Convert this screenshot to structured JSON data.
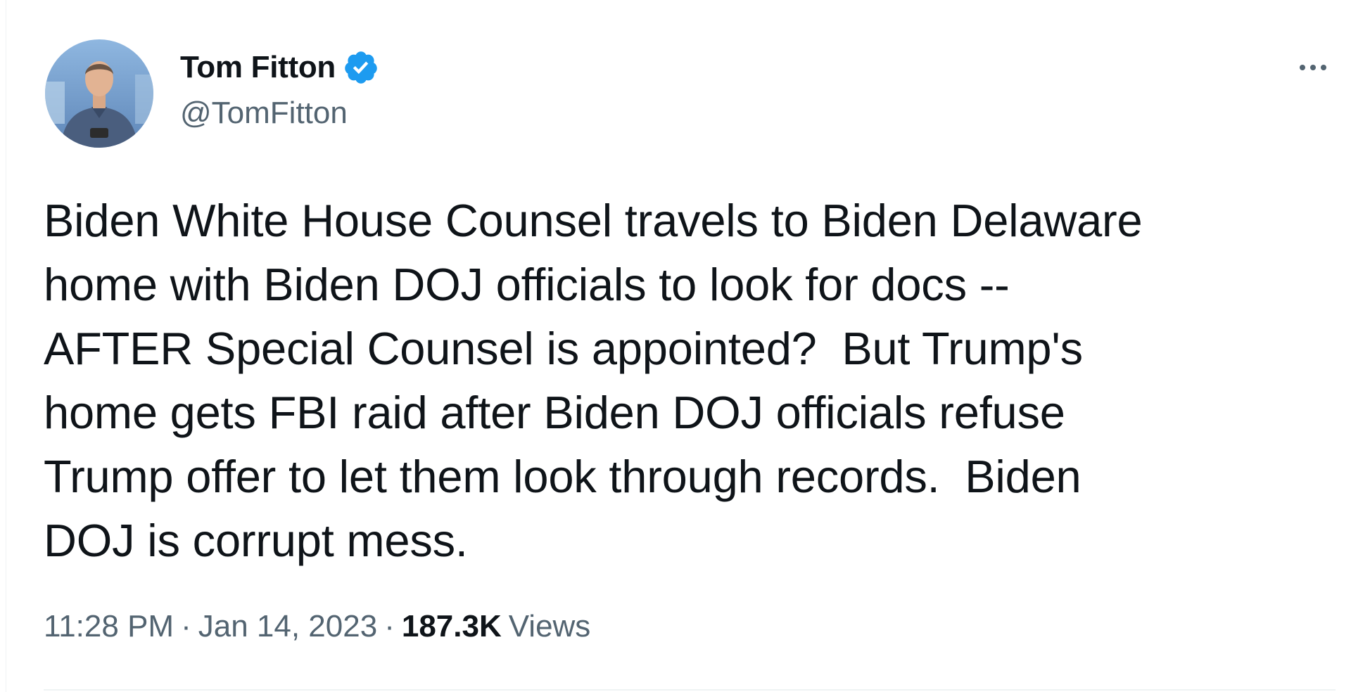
{
  "author": {
    "display_name": "Tom Fitton",
    "handle": "@TomFitton",
    "verified": true,
    "avatar_icon": "user-avatar-photo",
    "verified_icon": "verified-badge-icon",
    "more_icon": "more-horizontal-icon"
  },
  "tweet": {
    "text": "Biden White House Counsel travels to Biden Delaware\nhome with Biden DOJ officials to look for docs --\nAFTER Special Counsel is appointed?  But Trump's\nhome gets FBI raid after Biden DOJ officials refuse\nTrump offer to let them look through records.  Biden\nDOJ is corrupt mess.",
    "time": "11:28 PM",
    "date": "Jan 14, 2023",
    "separator": "·",
    "views_count": "187.3K",
    "views_label": "Views"
  },
  "colors": {
    "text_primary": "#0f1419",
    "text_secondary": "#536471",
    "verified_blue": "#1d9bf0",
    "divider": "#eff3f4"
  }
}
